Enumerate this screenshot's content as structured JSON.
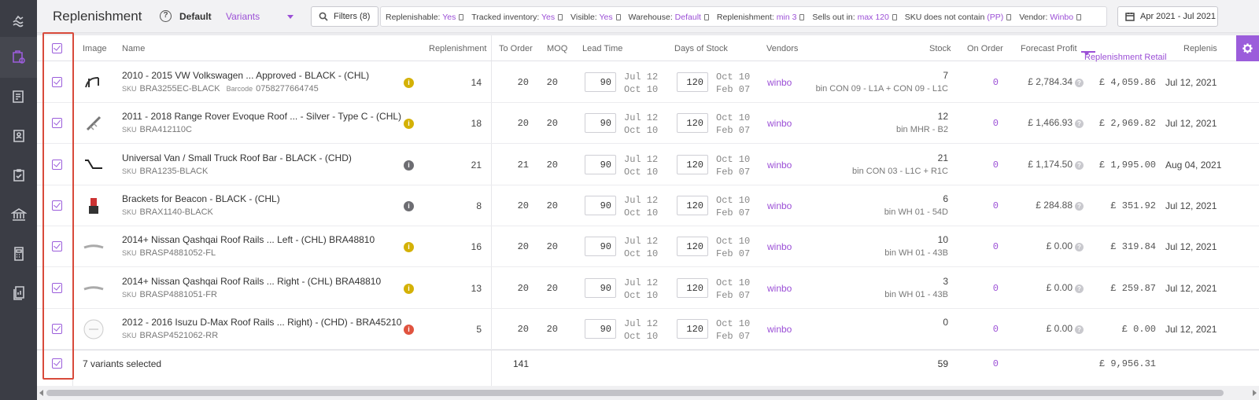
{
  "header": {
    "title": "Replenishment",
    "help_icon": "?",
    "view_default": "Default",
    "view_select": "Variants",
    "filters_button": "Filters (8)",
    "filters": [
      {
        "label": "Replenishable:",
        "value": "Yes"
      },
      {
        "label": "Tracked inventory:",
        "value": "Yes"
      },
      {
        "label": "Visible:",
        "value": "Yes"
      },
      {
        "label": "Warehouse:",
        "value": "Default"
      },
      {
        "label": "Replenishment:",
        "value": "min 3"
      },
      {
        "label": "Sells out in:",
        "value": "max 120"
      },
      {
        "label": "SKU does not contain",
        "value": "(PP)"
      },
      {
        "label": "Vendor:",
        "value": "Winbo"
      }
    ],
    "date_range": "Apr 2021 - Jul 2021"
  },
  "columns": {
    "image": "Image",
    "name": "Name",
    "replenishment": "Replenishment",
    "to_order": "To Order",
    "moq": "MOQ",
    "lead_time": "Lead Time",
    "days_of_stock": "Days of Stock",
    "vendors": "Vendors",
    "stock": "Stock",
    "on_order": "On Order",
    "forecast_profit": "Forecast Profit",
    "replenishment_retail": "Replenishment Retail",
    "replenish_cut": "Replenis"
  },
  "sku_key": "SKU",
  "barcode_key": "Barcode",
  "rows": [
    {
      "name": "2010 - 2015 VW Volkswagen ... Approved - BLACK - (CHL)",
      "sku": "BRA3255EC-BLACK",
      "barcode": "0758277664745",
      "info": "i",
      "info_color": "#d4b106",
      "replenishment": "14",
      "to_order": "20",
      "moq": "20",
      "lead_time": "90",
      "lt_from": "Jul 12",
      "lt_to": "Oct 10",
      "days_of_stock": "120",
      "ds_from": "Oct 10",
      "ds_to": "Feb 07",
      "vendor": "winbo",
      "stock": "7",
      "bin": "bin CON 09 - L1A + CON 09 - L1C",
      "on_order": "0",
      "forecast_profit": "£ 2,784.34",
      "replenishment_retail": "£ 4,059.86",
      "next_date": "Jul 12, 2021"
    },
    {
      "name": "2011 - 2018 Range Rover Evoque Roof ... - Silver - Type C - (CHL)",
      "sku": "BRA412110C",
      "barcode": "",
      "info": "i",
      "info_color": "#d4b106",
      "replenishment": "18",
      "to_order": "20",
      "moq": "20",
      "lead_time": "90",
      "lt_from": "Jul 12",
      "lt_to": "Oct 10",
      "days_of_stock": "120",
      "ds_from": "Oct 10",
      "ds_to": "Feb 07",
      "vendor": "winbo",
      "stock": "12",
      "bin": "bin MHR - B2",
      "on_order": "0",
      "forecast_profit": "£ 1,466.93",
      "replenishment_retail": "£ 2,969.82",
      "next_date": "Jul 12, 2021"
    },
    {
      "name": "Universal Van / Small Truck Roof Bar - BLACK - (CHD)",
      "sku": "BRA1235-BLACK",
      "barcode": "",
      "info": "i",
      "info_color": "#6d6d72",
      "replenishment": "21",
      "to_order": "21",
      "moq": "20",
      "lead_time": "90",
      "lt_from": "Jul 12",
      "lt_to": "Oct 10",
      "days_of_stock": "120",
      "ds_from": "Oct 10",
      "ds_to": "Feb 07",
      "vendor": "winbo",
      "stock": "21",
      "bin": "bin CON 03 - L1C + R1C",
      "on_order": "0",
      "forecast_profit": "£ 1,174.50",
      "replenishment_retail": "£ 1,995.00",
      "next_date": "Aug 04, 2021"
    },
    {
      "name": "Brackets for Beacon - BLACK - (CHL)",
      "sku": "BRAX1140-BLACK",
      "barcode": "",
      "info": "i",
      "info_color": "#6d6d72",
      "replenishment": "8",
      "to_order": "20",
      "moq": "20",
      "lead_time": "90",
      "lt_from": "Jul 12",
      "lt_to": "Oct 10",
      "days_of_stock": "120",
      "ds_from": "Oct 10",
      "ds_to": "Feb 07",
      "vendor": "winbo",
      "stock": "6",
      "bin": "bin WH 01 - 54D",
      "on_order": "0",
      "forecast_profit": "£ 284.88",
      "replenishment_retail": "£ 351.92",
      "next_date": "Jul 12, 2021"
    },
    {
      "name": "2014+ Nissan Qashqai Roof Rails ... Left - (CHL) BRA48810",
      "sku": "BRASP4881052-FL",
      "barcode": "",
      "info": "i",
      "info_color": "#d4b106",
      "replenishment": "16",
      "to_order": "20",
      "moq": "20",
      "lead_time": "90",
      "lt_from": "Jul 12",
      "lt_to": "Oct 10",
      "days_of_stock": "120",
      "ds_from": "Oct 10",
      "ds_to": "Feb 07",
      "vendor": "winbo",
      "stock": "10",
      "bin": "bin WH 01 - 43B",
      "on_order": "0",
      "forecast_profit": "£ 0.00",
      "replenishment_retail": "£ 319.84",
      "next_date": "Jul 12, 2021"
    },
    {
      "name": "2014+ Nissan Qashqai Roof Rails ... Right - (CHL) BRA48810",
      "sku": "BRASP4881051-FR",
      "barcode": "",
      "info": "i",
      "info_color": "#d4b106",
      "replenishment": "13",
      "to_order": "20",
      "moq": "20",
      "lead_time": "90",
      "lt_from": "Jul 12",
      "lt_to": "Oct 10",
      "days_of_stock": "120",
      "ds_from": "Oct 10",
      "ds_to": "Feb 07",
      "vendor": "winbo",
      "stock": "3",
      "bin": "bin WH 01 - 43B",
      "on_order": "0",
      "forecast_profit": "£ 0.00",
      "replenishment_retail": "£ 259.87",
      "next_date": "Jul 12, 2021"
    },
    {
      "name": "2012 - 2016 Isuzu D-Max Roof Rails ... Right) - (CHD) - BRA45210",
      "sku": "BRASP4521062-RR",
      "barcode": "",
      "info": "i",
      "info_color": "#e0533f",
      "replenishment": "5",
      "to_order": "20",
      "moq": "20",
      "lead_time": "90",
      "lt_from": "Jul 12",
      "lt_to": "Oct 10",
      "days_of_stock": "120",
      "ds_from": "Oct 10",
      "ds_to": "Feb 07",
      "vendor": "winbo",
      "stock": "0",
      "bin": "",
      "on_order": "0",
      "forecast_profit": "£ 0.00",
      "replenishment_retail": "£ 0.00",
      "next_date": "Jul 12, 2021"
    }
  ],
  "footer": {
    "selected_label": "7 variants selected",
    "to_order_total": "141",
    "stock_total": "59",
    "on_order_total": "0",
    "retail_total": "£ 9,956.31"
  },
  "colors": {
    "accent": "#9b5ddb",
    "highlight_frame": "#d84a3b",
    "sidebar": "#3b3d45"
  }
}
